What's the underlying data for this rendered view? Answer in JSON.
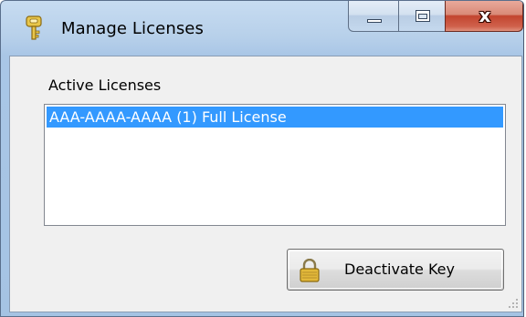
{
  "window": {
    "title": "Manage Licenses",
    "icon": "key-icon",
    "controls": {
      "minimize": "minimize-icon",
      "maximize": "maximize-icon",
      "close": "close-icon",
      "close_glyph": "x"
    }
  },
  "licenses": {
    "label": "Active Licenses",
    "items": [
      {
        "text": "AAA-AAAA-AAAA (1) Full License",
        "selected": true
      }
    ]
  },
  "actions": {
    "deactivate_label": "Deactivate Key",
    "deactivate_icon": "lock-icon"
  },
  "colors": {
    "selection": "#3399ff",
    "frame": "#b7d0ea",
    "client_bg": "#f0f0f0",
    "close_button": "#c2452f"
  }
}
